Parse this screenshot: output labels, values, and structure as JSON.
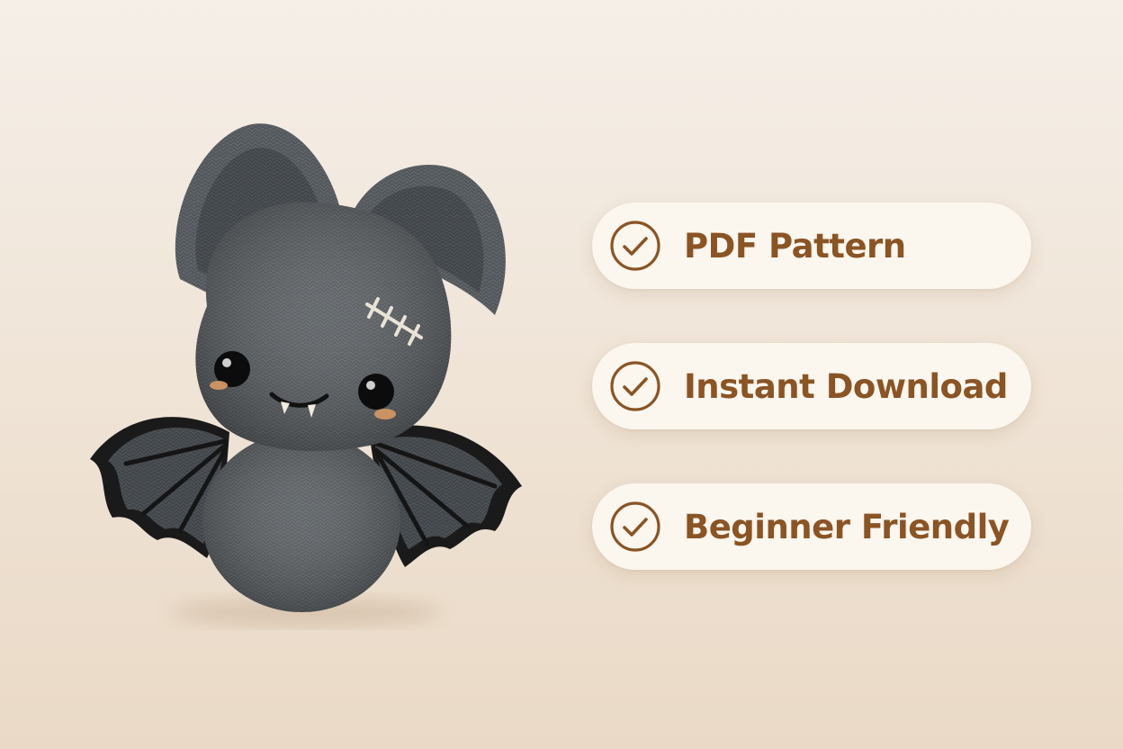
{
  "colors": {
    "accent": "#8a5425",
    "pill_background": "#fbf6ee",
    "background_top": "#f5efe8",
    "background_bottom": "#ead9c6",
    "yarn_gray": "#5d6266",
    "wing_black": "#151515"
  },
  "product_image": {
    "icon": "crochet-bat-amigurumi"
  },
  "features": [
    {
      "icon": "check-circle-icon",
      "label": "PDF Pattern"
    },
    {
      "icon": "check-circle-icon",
      "label": "Instant Download"
    },
    {
      "icon": "check-circle-icon",
      "label": "Beginner Friendly"
    }
  ]
}
